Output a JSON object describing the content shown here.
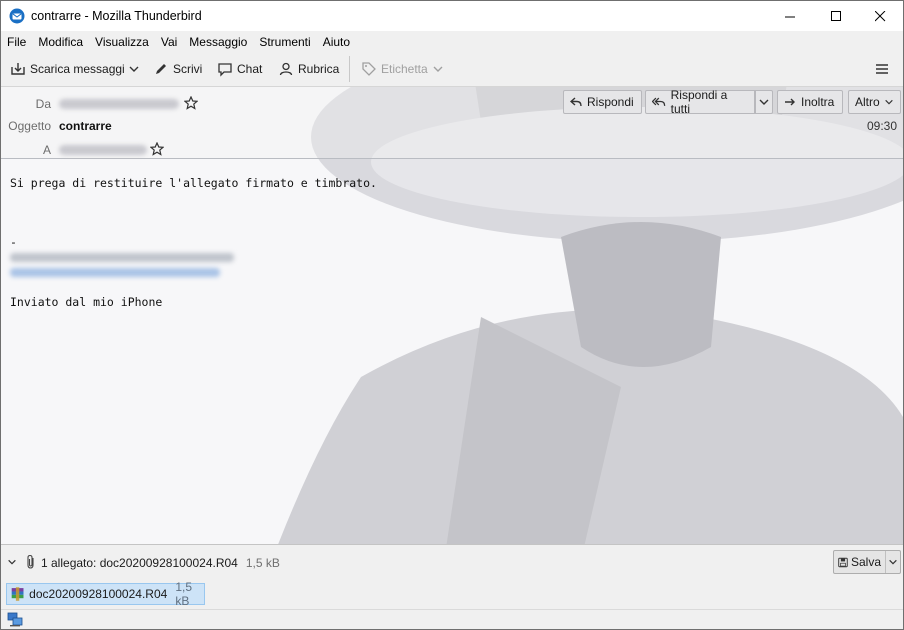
{
  "window": {
    "title": "contrarre - Mozilla Thunderbird"
  },
  "menu": {
    "items": [
      "File",
      "Modifica",
      "Visualizza",
      "Vai",
      "Messaggio",
      "Strumenti",
      "Aiuto"
    ]
  },
  "toolbar": {
    "get_messages": "Scarica messaggi",
    "write": "Scrivi",
    "chat": "Chat",
    "address_book": "Rubrica",
    "tag": "Etichetta"
  },
  "header": {
    "from_label": "Da",
    "subject_label": "Oggetto",
    "subject": "contrarre",
    "to_label": "A",
    "time": "09:30",
    "reply": "Rispondi",
    "reply_all": "Rispondi a tutti",
    "forward": "Inoltra",
    "more": "Altro"
  },
  "body": {
    "line1": "Si prega di restituire l'allegato firmato e timbrato.",
    "sig_dash": "-",
    "sent_from": "Inviato dal mio iPhone"
  },
  "attachments": {
    "summary": "1 allegato: doc20200928100024.R04",
    "summary_size": "1,5 kB",
    "save": "Salva",
    "file_name": "doc20200928100024.R04",
    "file_size": "1,5 kB"
  }
}
